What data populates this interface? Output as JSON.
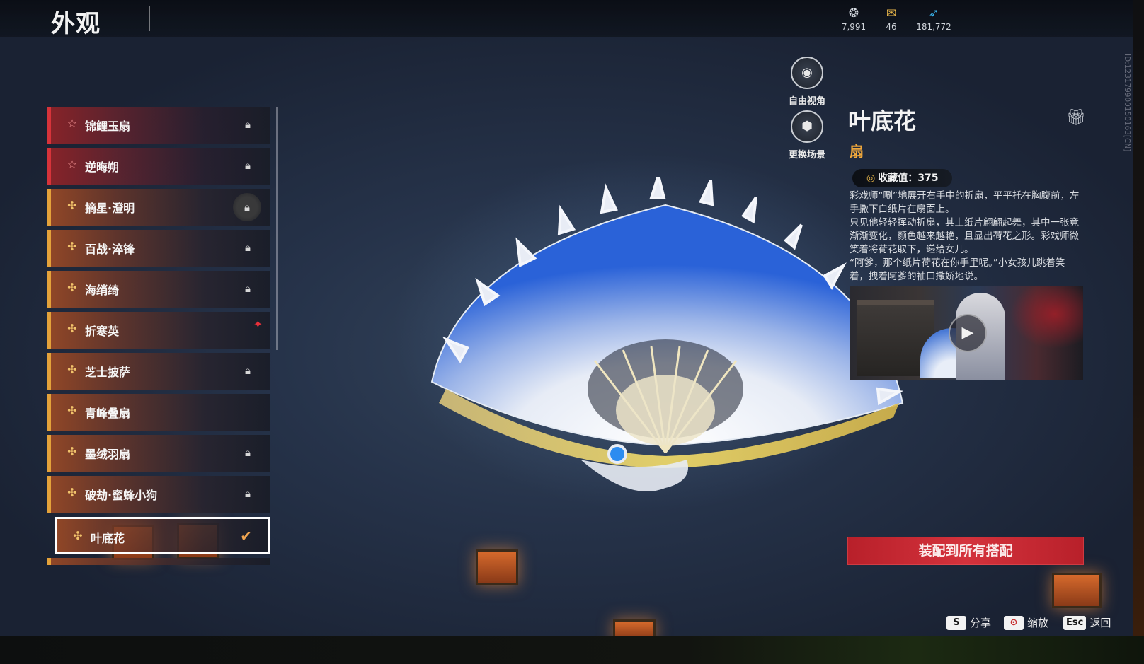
{
  "header": {
    "title": "外观",
    "currencies": [
      {
        "icon": "lotus-coin-icon",
        "value": "7,991"
      },
      {
        "icon": "ticket-icon",
        "value": "46"
      },
      {
        "icon": "feather-icon",
        "value": "181,772"
      }
    ]
  },
  "list": {
    "items": [
      {
        "label": "锦鲤玉扇",
        "rarity": "red",
        "status": "locked"
      },
      {
        "label": "逆晦朔",
        "rarity": "red",
        "status": "locked"
      },
      {
        "label": "摘星·澄明",
        "rarity": "gold",
        "status": "locked-ringed"
      },
      {
        "label": "百战·淬锋",
        "rarity": "gold",
        "status": "locked"
      },
      {
        "label": "海绡绮",
        "rarity": "gold",
        "status": "locked"
      },
      {
        "label": "折寒英",
        "rarity": "gold",
        "status": "new"
      },
      {
        "label": "芝士披萨",
        "rarity": "gold",
        "status": "locked"
      },
      {
        "label": "青峰叠扇",
        "rarity": "gold",
        "status": "none"
      },
      {
        "label": "墨绒羽扇",
        "rarity": "gold",
        "status": "locked"
      },
      {
        "label": "破劫·蜜蜂小狗",
        "rarity": "gold",
        "status": "locked"
      },
      {
        "label": "叶底花",
        "rarity": "gold",
        "status": "equipped"
      }
    ]
  },
  "camera": {
    "free_view": "自由视角",
    "change_scene": "更换场景"
  },
  "detail": {
    "name": "叶底花",
    "type": "扇",
    "collect_label": "收藏值：375",
    "description": [
      "彩戏师“唰”地展开右手中的折扇，平平托在胸腹前，左手撒下白纸片在扇面上。",
      "只见他轻轻挥动折扇，其上纸片翩翩起舞，其中一张竟渐渐变化，颜色越来越艳，且显出荷花之形。彩戏师微笑着将荷花取下，递给女儿。",
      "“阿爹，那个纸片荷花在你手里呢。”小女孩儿跳着笑着，拽着阿爹的袖口撒娇地说。"
    ],
    "equip_button": "装配到所有搭配"
  },
  "hotkeys": [
    {
      "key": "S",
      "label": "分享"
    },
    {
      "key": "",
      "label": "缩放"
    },
    {
      "key": "Esc",
      "label": "返回"
    }
  ],
  "id_text": "ID:1231799001501​63[CN]",
  "colors": {
    "accent_gold": "#e4a23a",
    "accent_red": "#d6333a",
    "equip_red": "#c8262f",
    "type_orange": "#f0a83c"
  }
}
